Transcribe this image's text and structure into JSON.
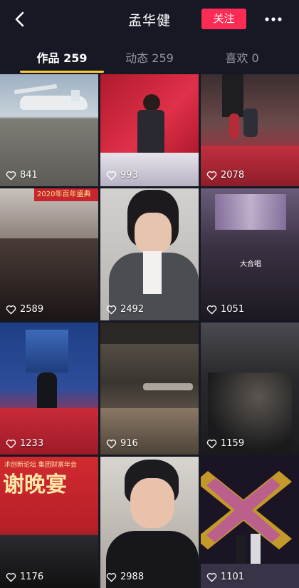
{
  "header": {
    "title": "孟华健",
    "follow_label": "关注",
    "back_icon": "chevron-left-icon",
    "more_icon": "more-dots-icon",
    "accent": "#fe2c55"
  },
  "tabs": [
    {
      "label": "作品 259",
      "active": true
    },
    {
      "label": "动态 259",
      "active": false
    },
    {
      "label": "喜欢 0",
      "active": false
    }
  ],
  "indicator_color": "#facd3b",
  "videos": [
    {
      "likes": "841"
    },
    {
      "likes": "993"
    },
    {
      "likes": "2078"
    },
    {
      "likes": "2589",
      "banner": "2020年百年盛典"
    },
    {
      "likes": "2492"
    },
    {
      "likes": "1051",
      "caption": "大合唱"
    },
    {
      "likes": "1233"
    },
    {
      "likes": "916"
    },
    {
      "likes": "1159"
    },
    {
      "likes": "1176",
      "banner": "谢晚宴",
      "banner_top": "术创新论坛 集团财富年会"
    },
    {
      "likes": "2988"
    },
    {
      "likes": "1101"
    }
  ]
}
